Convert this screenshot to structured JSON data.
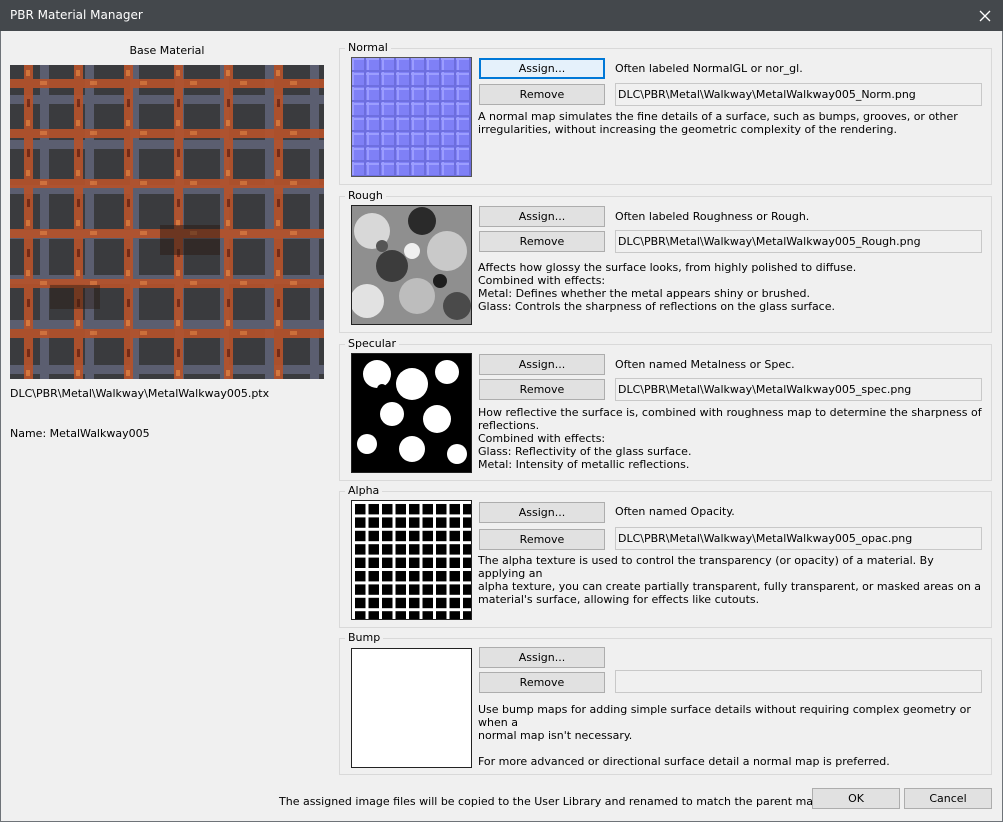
{
  "window": {
    "title": "PBR Material Manager"
  },
  "base": {
    "title": "Base Material",
    "path": "DLC\\PBR\\Metal\\Walkway\\MetalWalkway005.ptx",
    "name": "Name: MetalWalkway005"
  },
  "buttons": {
    "assign": "Assign...",
    "remove": "Remove"
  },
  "maps": {
    "normal": {
      "legend": "Normal",
      "hint": "Often labeled NormalGL or nor_gl.",
      "path": "DLC\\PBR\\Metal\\Walkway\\MetalWalkway005_Norm.png",
      "desc": "A normal map simulates the fine details of a surface, such as bumps, grooves, or other\nirregularities, without increasing the geometric complexity of the rendering."
    },
    "rough": {
      "legend": "Rough",
      "hint": "Often labeled Roughness or Rough.",
      "path": "DLC\\PBR\\Metal\\Walkway\\MetalWalkway005_Rough.png",
      "desc": "Affects how glossy the surface looks, from highly polished to diffuse.\nCombined with effects:\nMetal: Defines whether the metal appears shiny or brushed.\nGlass: Controls the sharpness of reflections on the glass surface."
    },
    "specular": {
      "legend": "Specular",
      "hint": "Often named Metalness or Spec.",
      "path": "DLC\\PBR\\Metal\\Walkway\\MetalWalkway005_spec.png",
      "desc": "How reflective the surface is, combined with roughness map to determine the sharpness of\nreflections.\nCombined with effects:\nGlass: Reflectivity of the glass surface.\nMetal: Intensity of metallic reflections."
    },
    "alpha": {
      "legend": "Alpha",
      "hint": "Often named Opacity.",
      "path": "DLC\\PBR\\Metal\\Walkway\\MetalWalkway005_opac.png",
      "desc": "The alpha texture is used to control the transparency (or opacity) of a material. By applying an\nalpha texture, you can create partially transparent, fully transparent, or masked areas on a\nmaterial's surface, allowing for effects like cutouts."
    },
    "bump": {
      "legend": "Bump",
      "hint": "",
      "path": "",
      "desc": "Use bump maps for adding simple surface details without requiring complex geometry or when a\nnormal map isn't necessary.\n\nFor more advanced or directional surface detail a normal map is preferred."
    }
  },
  "footer": {
    "note": "The assigned image files will be copied to the User Library and renamed to match the parent material.",
    "ok": "OK",
    "cancel": "Cancel"
  },
  "colors": {
    "titlebar": "#44484c",
    "normal_map": "#7f7ff5",
    "rust": "#b5522a",
    "steel": "#5b5e70",
    "focus_blue": "#0078d7"
  }
}
